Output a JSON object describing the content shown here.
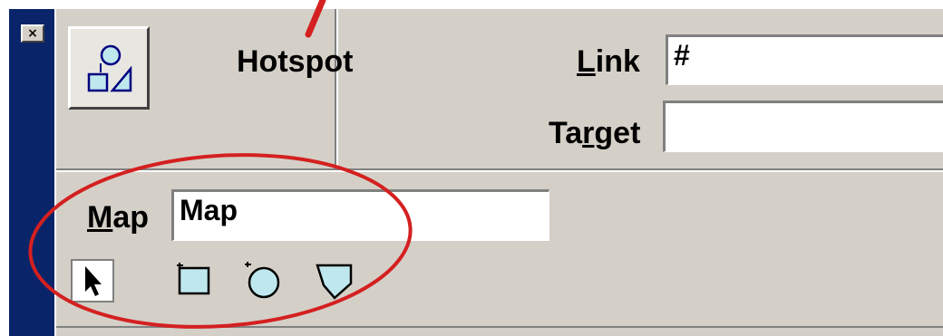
{
  "window": {
    "close_label": "×"
  },
  "hotspot": {
    "title": "Hotspot",
    "icon": "hotspot-shapes-icon"
  },
  "link": {
    "label_prefix": "",
    "label_mnemonic": "L",
    "label_rest": "ink",
    "value": "#"
  },
  "target": {
    "label_prefix": "Ta",
    "label_mnemonic": "r",
    "label_rest": "get",
    "value": ""
  },
  "map": {
    "label_prefix": "",
    "label_mnemonic": "M",
    "label_rest": "ap",
    "value": "Map"
  },
  "tools": [
    {
      "name": "pointer-tool-icon",
      "selected": true
    },
    {
      "name": "rectangle-hotspot-icon",
      "selected": false
    },
    {
      "name": "circle-hotspot-icon",
      "selected": false
    },
    {
      "name": "polygon-hotspot-icon",
      "selected": false
    }
  ],
  "colors": {
    "panel": "#d4d0c8",
    "titlebar": "#0a246a",
    "annotation": "#d42020",
    "hotspot_fill": "#bfe8ee"
  }
}
